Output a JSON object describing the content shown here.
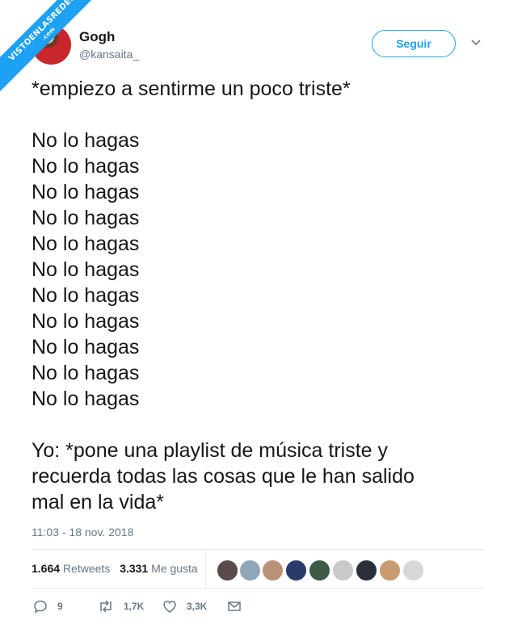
{
  "watermark": {
    "main": "VISTOENLASREDES",
    "sub": ".com"
  },
  "user": {
    "name": "Gogh",
    "handle": "@kansaita_"
  },
  "follow_label": "Seguir",
  "tweet": {
    "intro": "*empiezo a sentirme un poco triste*",
    "repeated": [
      "No lo hagas",
      "No lo hagas",
      "No lo hagas",
      "No lo hagas",
      "No lo hagas",
      "No lo hagas",
      "No lo hagas",
      "No lo hagas",
      "No lo hagas",
      "No lo hagas",
      "No lo hagas"
    ],
    "ending": [
      "Yo: *pone una playlist de música triste y",
      "recuerda todas las cosas que le han salido",
      "mal en la vida*"
    ]
  },
  "timestamp": "11:03 - 18 nov. 2018",
  "stats": {
    "retweets_count": "1.664",
    "retweets_label": "Retweets",
    "likes_count": "3.331",
    "likes_label": "Me gusta"
  },
  "likers_colors": [
    "#5a4a4a",
    "#8fa6b8",
    "#b99279",
    "#2b3a6b",
    "#3c5a46",
    "#c9c9c9",
    "#2a2f3a",
    "#c89a70",
    "#d8d8d8"
  ],
  "actions": {
    "replies": "9",
    "retweets": "1,7K",
    "likes": "3,3K"
  },
  "icons": {
    "reply": "reply-icon",
    "retweet": "retweet-icon",
    "like": "heart-icon",
    "dm": "envelope-icon",
    "caret": "chevron-down-icon"
  },
  "colors": {
    "accent": "#1da1f2",
    "secondary_text": "#657786",
    "text": "#14171a"
  }
}
